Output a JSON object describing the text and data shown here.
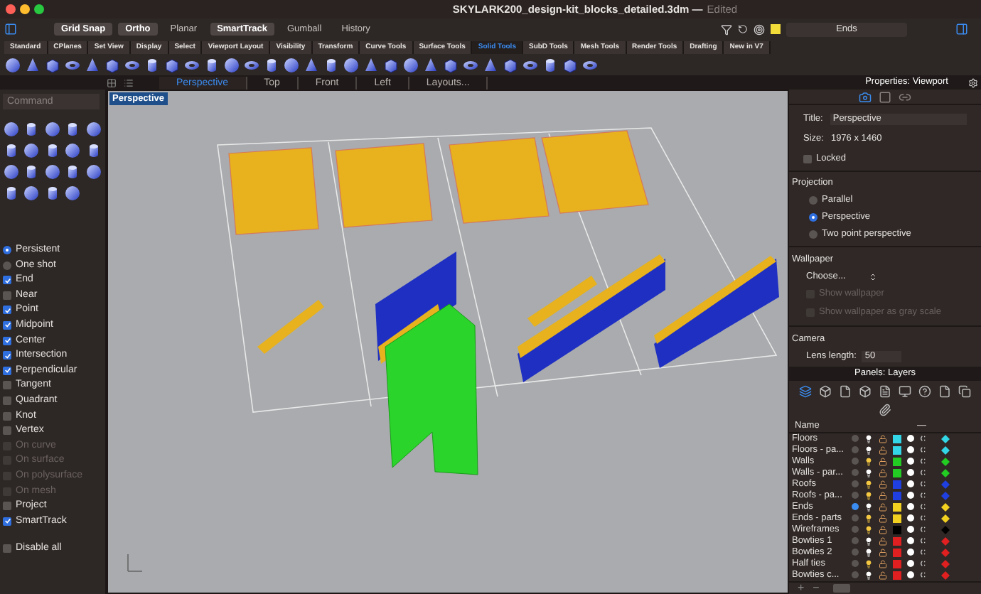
{
  "window": {
    "title": "SKYLARK200_design-kit_blocks_detailed.3dm —",
    "status": "Edited"
  },
  "modes": [
    {
      "label": "Grid Snap",
      "on": true
    },
    {
      "label": "Ortho",
      "on": true
    },
    {
      "label": "Planar",
      "on": false
    },
    {
      "label": "SmartTrack",
      "on": true
    },
    {
      "label": "Gumball",
      "on": false
    },
    {
      "label": "History",
      "on": false
    }
  ],
  "current_layer": {
    "value": "Ends",
    "color": "#f2dc3a"
  },
  "toolbar_tabs": [
    {
      "label": "Standard",
      "selected": false
    },
    {
      "label": "CPlanes",
      "selected": false
    },
    {
      "label": "Set View",
      "selected": false
    },
    {
      "label": "Display",
      "selected": false
    },
    {
      "label": "Select",
      "selected": false
    },
    {
      "label": "Viewport Layout",
      "selected": false
    },
    {
      "label": "Visibility",
      "selected": false
    },
    {
      "label": "Transform",
      "selected": false
    },
    {
      "label": "Curve Tools",
      "selected": false
    },
    {
      "label": "Surface Tools",
      "selected": false
    },
    {
      "label": "Solid Tools",
      "selected": true
    },
    {
      "label": "SubD Tools",
      "selected": false
    },
    {
      "label": "Mesh Tools",
      "selected": false
    },
    {
      "label": "Render Tools",
      "selected": false
    },
    {
      "label": "Drafting",
      "selected": false
    },
    {
      "label": "New in V7",
      "selected": false
    }
  ],
  "viewport_tabs": [
    {
      "label": "Perspective",
      "selected": true
    },
    {
      "label": "Top",
      "selected": false
    },
    {
      "label": "Front",
      "selected": false
    },
    {
      "label": "Left",
      "selected": false
    },
    {
      "label": "Layouts...",
      "selected": false
    }
  ],
  "command": {
    "placeholder": "Command"
  },
  "osnap": {
    "modes": [
      {
        "label": "Persistent",
        "selected": true
      },
      {
        "label": "One shot",
        "selected": false
      }
    ],
    "items": [
      {
        "label": "End",
        "checked": true,
        "disabled": false
      },
      {
        "label": "Near",
        "checked": false,
        "disabled": false
      },
      {
        "label": "Point",
        "checked": true,
        "disabled": false
      },
      {
        "label": "Midpoint",
        "checked": true,
        "disabled": false
      },
      {
        "label": "Center",
        "checked": true,
        "disabled": false
      },
      {
        "label": "Intersection",
        "checked": true,
        "disabled": false
      },
      {
        "label": "Perpendicular",
        "checked": true,
        "disabled": false
      },
      {
        "label": "Tangent",
        "checked": false,
        "disabled": false
      },
      {
        "label": "Quadrant",
        "checked": false,
        "disabled": false
      },
      {
        "label": "Knot",
        "checked": false,
        "disabled": false
      },
      {
        "label": "Vertex",
        "checked": false,
        "disabled": false
      },
      {
        "label": "On curve",
        "checked": false,
        "disabled": true
      },
      {
        "label": "On surface",
        "checked": false,
        "disabled": true
      },
      {
        "label": "On polysurface",
        "checked": false,
        "disabled": true
      },
      {
        "label": "On mesh",
        "checked": false,
        "disabled": true
      },
      {
        "label": "Project",
        "checked": false,
        "disabled": false
      },
      {
        "label": "SmartTrack",
        "checked": true,
        "disabled": false
      }
    ],
    "disable_all": {
      "label": "Disable all",
      "checked": false
    }
  },
  "viewport": {
    "label": "Perspective"
  },
  "properties": {
    "title": "Properties: Viewport",
    "panel_icons": [
      {
        "kind": "camera",
        "selected": true
      },
      {
        "kind": "display",
        "selected": false
      },
      {
        "kind": "link",
        "selected": false
      }
    ],
    "title_label": "Title:",
    "title_value": "Perspective",
    "size_label": "Size:",
    "size_value": "1976 x 1460",
    "locked": {
      "label": "Locked",
      "checked": false
    },
    "projection": {
      "heading": "Projection",
      "options": [
        {
          "label": "Parallel",
          "selected": false
        },
        {
          "label": "Perspective",
          "selected": true
        },
        {
          "label": "Two point perspective",
          "selected": false
        }
      ]
    },
    "wallpaper": {
      "heading": "Wallpaper",
      "choose": "Choose...",
      "options": [
        {
          "label": "Show wallpaper",
          "checked": false,
          "disabled": true
        },
        {
          "label": "Show wallpaper as gray scale",
          "checked": false,
          "disabled": true
        }
      ]
    },
    "camera": {
      "heading": "Camera",
      "lens_label": "Lens length:",
      "lens_value": "50"
    }
  },
  "layers": {
    "title": "Panels: Layers",
    "columns": [
      "Name",
      "—"
    ],
    "rows": [
      {
        "name": "Floors",
        "current": false,
        "lit": false,
        "color": "#33d6e6"
      },
      {
        "name": "Floors - pa...",
        "current": false,
        "lit": false,
        "color": "#33d6e6"
      },
      {
        "name": "Walls",
        "current": false,
        "lit": true,
        "color": "#22cc22"
      },
      {
        "name": "Walls - par...",
        "current": false,
        "lit": false,
        "color": "#22cc22"
      },
      {
        "name": "Roofs",
        "current": false,
        "lit": true,
        "color": "#1f3fe0"
      },
      {
        "name": "Roofs - pa...",
        "current": false,
        "lit": true,
        "color": "#1f3fe0"
      },
      {
        "name": "Ends",
        "current": true,
        "lit": false,
        "color": "#f2d020"
      },
      {
        "name": "Ends - parts",
        "current": false,
        "lit": true,
        "color": "#f2d020"
      },
      {
        "name": "Wireframes",
        "current": false,
        "lit": true,
        "color": "#000000"
      },
      {
        "name": "Bowties 1",
        "current": false,
        "lit": false,
        "color": "#e02020"
      },
      {
        "name": "Bowties 2",
        "current": false,
        "lit": false,
        "color": "#e02020"
      },
      {
        "name": "Half ties",
        "current": false,
        "lit": true,
        "color": "#e02020"
      },
      {
        "name": "Bowties c...",
        "current": false,
        "lit": false,
        "color": "#e02020"
      }
    ],
    "footer": [
      "+",
      "−"
    ]
  }
}
